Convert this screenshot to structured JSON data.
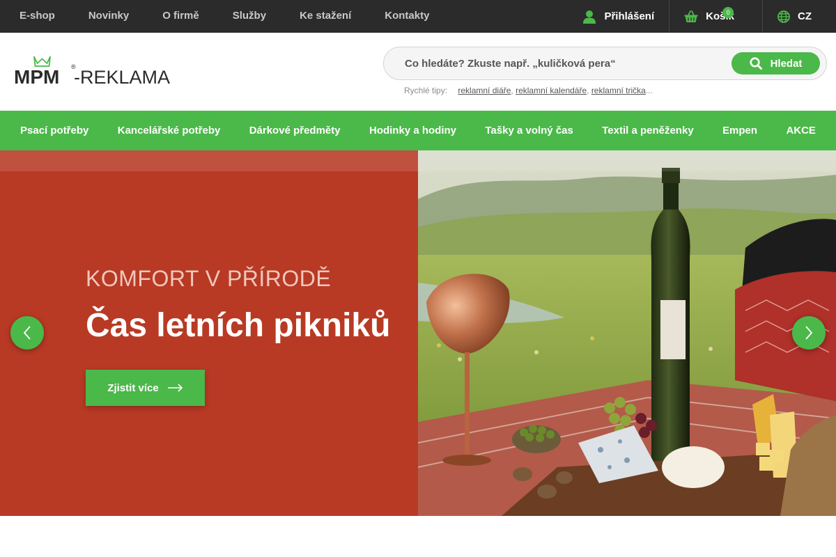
{
  "top_nav": {
    "links": [
      "E-shop",
      "Novinky",
      "O firmě",
      "Služby",
      "Ke stažení",
      "Kontakty"
    ],
    "login_label": "Přihlášení",
    "cart_label": "Košík",
    "cart_count": "0",
    "language": "CZ"
  },
  "header": {
    "logo_text_mpm": "MPM",
    "logo_text_reklama": "-REKLAMA",
    "logo_reg": "®",
    "search_placeholder": "Co hledáte? Zkuste např. „kuličková pera“",
    "search_button": "Hledat",
    "tips_label": "Rychlé tipy:",
    "tips": [
      "reklamní diáře",
      "reklamní kalendáře",
      "reklamní trička"
    ],
    "tips_ellipsis": "..."
  },
  "category_nav": {
    "items": [
      "Psací potřeby",
      "Kancelářské potřeby",
      "Dárkové předměty",
      "Hodinky a hodiny",
      "Tašky a volný čas",
      "Textil a peněženky",
      "Empen",
      "AKCE"
    ]
  },
  "hero": {
    "subtitle": "KOMFORT V PŘÍRODĚ",
    "title": "Čas letních pikniků",
    "cta_label": "Zjistit více"
  },
  "colors": {
    "brand_green": "#4bb84a",
    "topbar_bg": "#2b2b2b",
    "hero_red": "#b83a24"
  },
  "icons": [
    "user-icon",
    "basket-icon",
    "globe-icon",
    "search-icon",
    "arrow-right-icon",
    "chevron-left-icon",
    "chevron-right-icon",
    "crown-icon"
  ]
}
